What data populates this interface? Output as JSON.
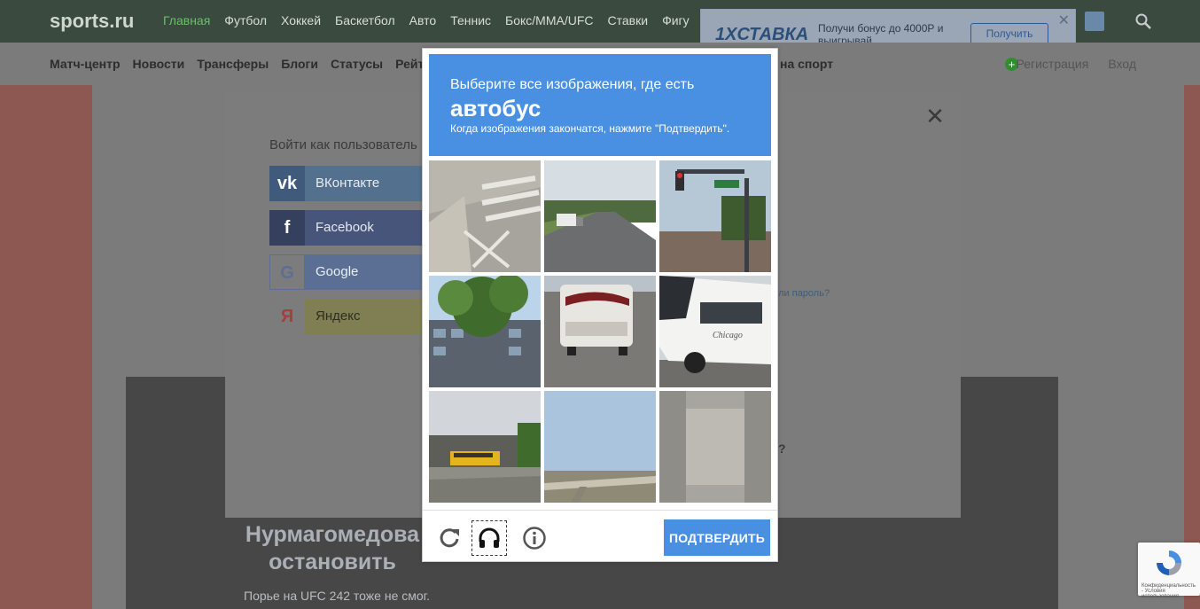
{
  "site": {
    "logo": "sports.ru",
    "main_nav": [
      "Главная",
      "Футбол",
      "Хоккей",
      "Баскетбол",
      "Авто",
      "Теннис",
      "Бокс/ММА/UFC",
      "Ставки",
      "Фигу"
    ],
    "sub_nav": [
      "Матч-центр",
      "Новости",
      "Трансферы",
      "Блоги",
      "Статусы",
      "Рейти"
    ],
    "sub_nav_right": "на спорт",
    "auth": {
      "register": "Регистрация",
      "login": "Вход"
    }
  },
  "ad_banner": {
    "logo": "1XСТАВКА",
    "text": "Получи бонус до 4000Р и выигрывай",
    "button": "Получить"
  },
  "hero": {
    "title": "Нурмагомедова остановить",
    "subtitle": "Порье на UFC 242 тоже не смог."
  },
  "login_modal": {
    "title": "Войти как пользователь",
    "providers": [
      {
        "icon": "vk-icon",
        "label": "ВКонтакте"
      },
      {
        "icon": "facebook-icon",
        "label": "Facebook"
      },
      {
        "icon": "google-icon",
        "label": "Google"
      },
      {
        "icon": "yandex-icon",
        "label": "Яндекс"
      }
    ],
    "forgot": "али пароль?",
    "question_mark": "?"
  },
  "captcha": {
    "instruction": "Выберите все изображения, где есть",
    "object": "автобус",
    "hint": "Когда изображения закончатся, нажмите \"Подтвердить\".",
    "tiles": [
      "crosswalk",
      "highway-truck",
      "traffic-light",
      "building-tree",
      "rv-bus",
      "white-bus",
      "school-bus",
      "overpass",
      "concrete-wall"
    ],
    "verify_button": "ПОДТВЕРДИТЬ",
    "footer_icons": [
      "reload-icon",
      "headphones-icon",
      "info-icon"
    ]
  },
  "recaptcha_badge": {
    "text": "Конфиденциальность - Условия использования"
  }
}
